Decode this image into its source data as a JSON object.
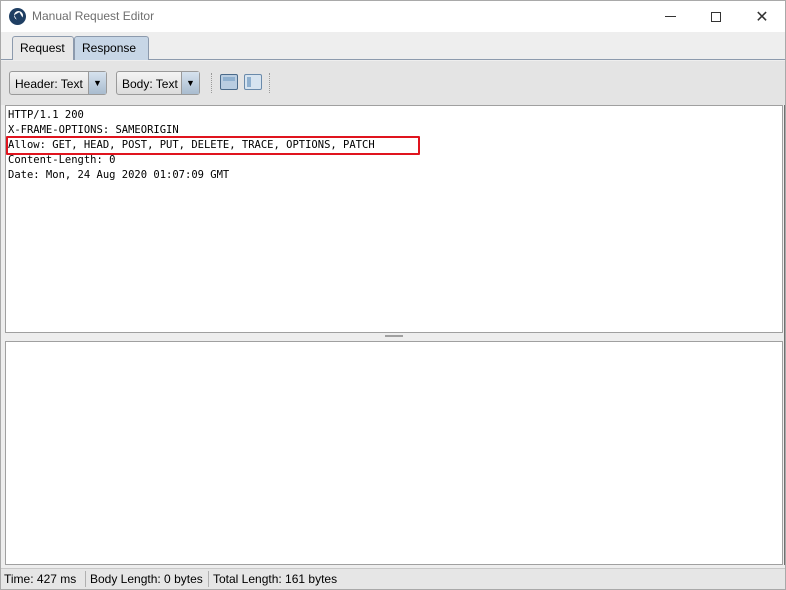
{
  "window": {
    "title": "Manual Request Editor",
    "close_glyph": "✕"
  },
  "tabs": [
    {
      "label": "Request",
      "selected": false
    },
    {
      "label": "Response",
      "selected": true
    }
  ],
  "toolbar": {
    "header_view": {
      "value": "Header: Text",
      "arrow": "▼"
    },
    "body_view": {
      "value": "Body: Text",
      "arrow": "▼"
    },
    "layout_buttons": [
      "split-horizontal-icon",
      "split-vertical-icon"
    ]
  },
  "response_header": {
    "lines": [
      "HTTP/1.1 200",
      "X-FRAME-OPTIONS: SAMEORIGIN",
      "Allow: GET, HEAD, POST, PUT, DELETE, TRACE, OPTIONS, PATCH",
      "Content-Length: 0",
      "Date: Mon, 24 Aug 2020 01:07:09 GMT"
    ],
    "highlighted_line_index": 2,
    "highlight_color": "#e0141e"
  },
  "response_body": {
    "text": ""
  },
  "status": {
    "time": "Time: 427 ms",
    "body_length": "Body Length: 0 bytes",
    "total_length": "Total Length: 161 bytes"
  },
  "colors": {
    "selected_tab": "#c7d6e6",
    "app_icon": "#1f3f63"
  }
}
